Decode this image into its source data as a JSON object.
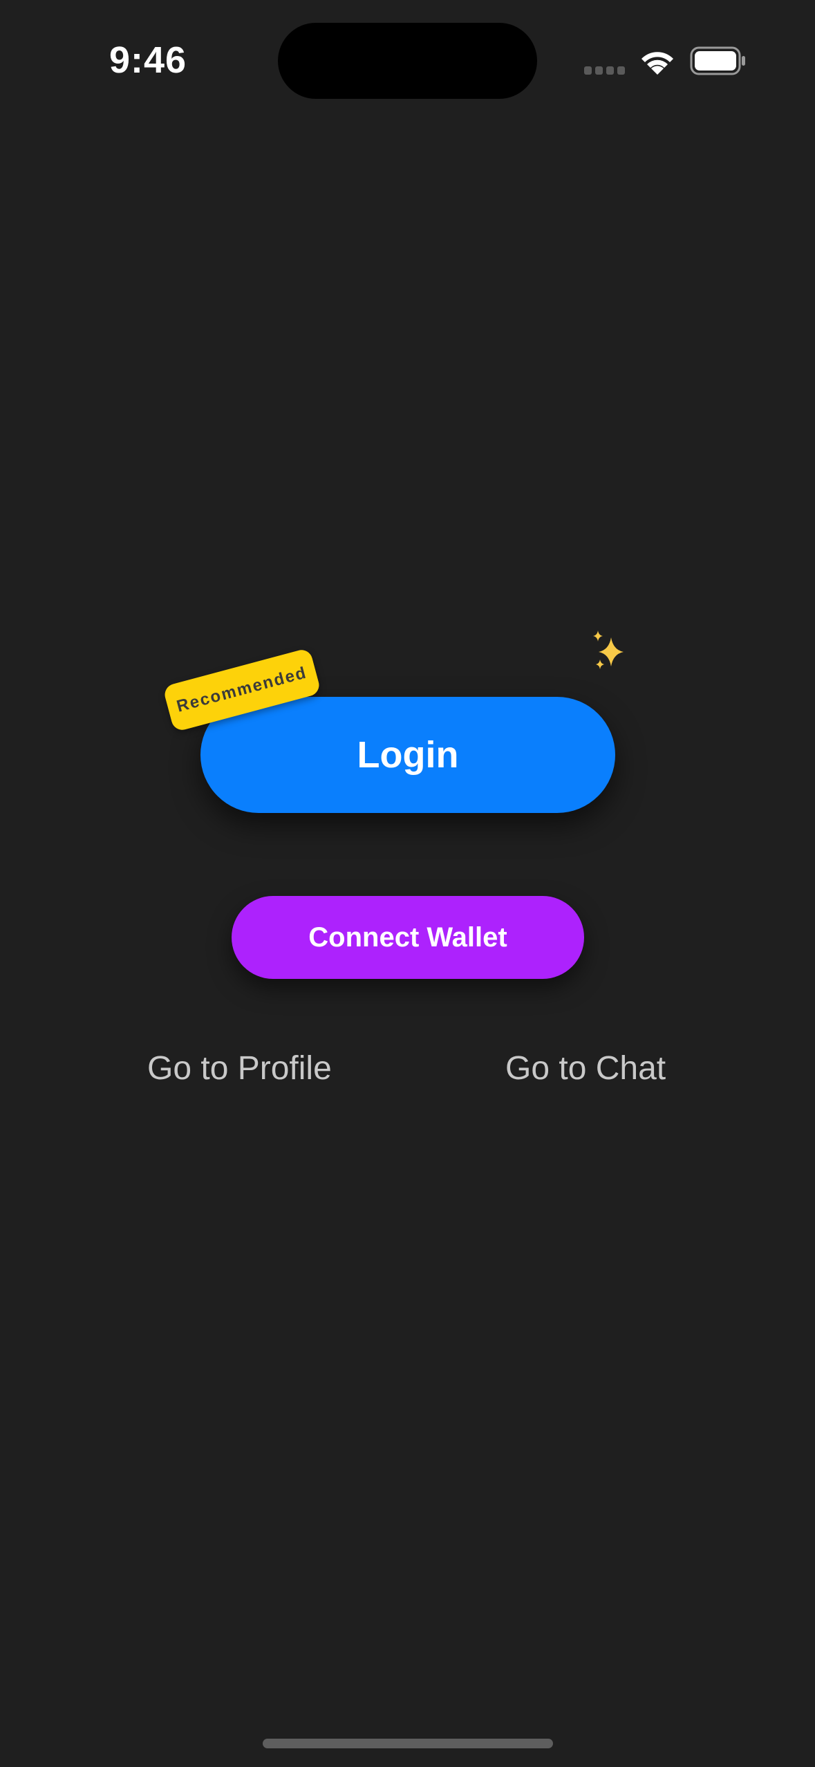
{
  "status_bar": {
    "time": "9:46"
  },
  "main": {
    "badge_label": "Recommended",
    "login_label": "Login",
    "wallet_label": "Connect Wallet",
    "profile_link": "Go to Profile",
    "chat_link": "Go to Chat",
    "decoration_icon": "sparkles-icon"
  },
  "colors": {
    "background": "#1f1f1f",
    "login_button": "#0a7ffd",
    "wallet_button": "#ad22fd",
    "badge": "#fdd20a",
    "link_text": "#c9c9c9"
  }
}
